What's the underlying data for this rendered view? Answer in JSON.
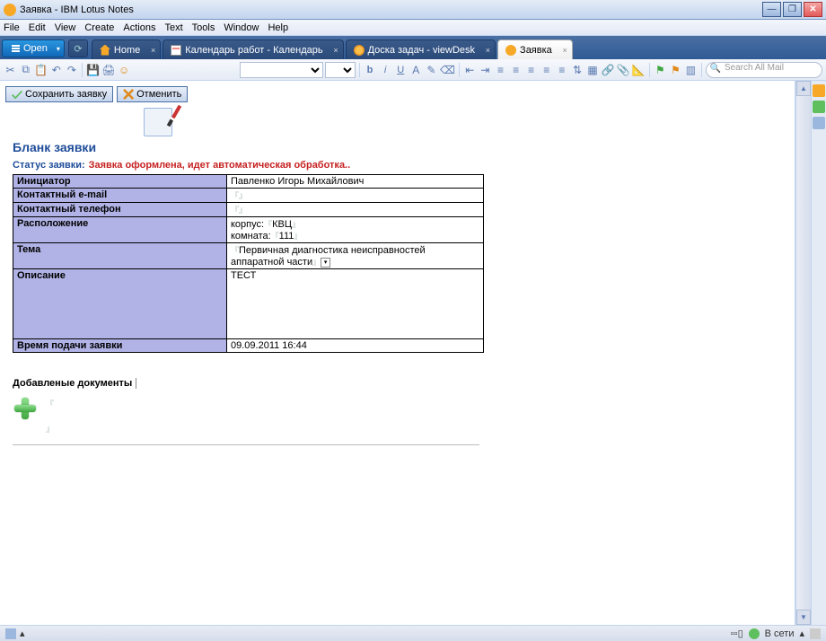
{
  "window": {
    "title": "Заявка - IBM Lotus Notes"
  },
  "menus": [
    "File",
    "Edit",
    "View",
    "Create",
    "Actions",
    "Text",
    "Tools",
    "Window",
    "Help"
  ],
  "open_btn": "Open",
  "tabs": [
    {
      "label": "Home"
    },
    {
      "label": "Календарь работ - Календарь"
    },
    {
      "label": "Доска задач - viewDesk"
    },
    {
      "label": "Заявка"
    }
  ],
  "search_placeholder": "Search All Mail",
  "actions": {
    "save": "Сохранить заявку",
    "cancel": "Отменить"
  },
  "form": {
    "title": "Бланк заявки",
    "status_label": "Статус заявки:",
    "status_value": "Заявка оформлена, идет автоматическая обработка..",
    "rows": {
      "initiator_lbl": "Инициатор",
      "initiator_val": "Павленко Игорь Михайлович",
      "email_lbl": "Контактный e-mail",
      "email_val": "",
      "phone_lbl": "Контактный телефон",
      "phone_val": "",
      "location_lbl": "Расположение",
      "location_corpus_lbl": "корпус:",
      "location_corpus_val": "КВЦ",
      "location_room_lbl": "комната:",
      "location_room_val": "111",
      "subject_lbl": "Тема",
      "subject_val": "Первичная диагностика неисправностей аппаратной части",
      "desc_lbl": "Описание",
      "desc_val": "ТЕСТ",
      "time_lbl": "Время подачи заявки",
      "time_val": "09.09.2011 16:44"
    }
  },
  "attachments_title": "Добавленые документы",
  "statusbar": {
    "network": "В сети"
  }
}
